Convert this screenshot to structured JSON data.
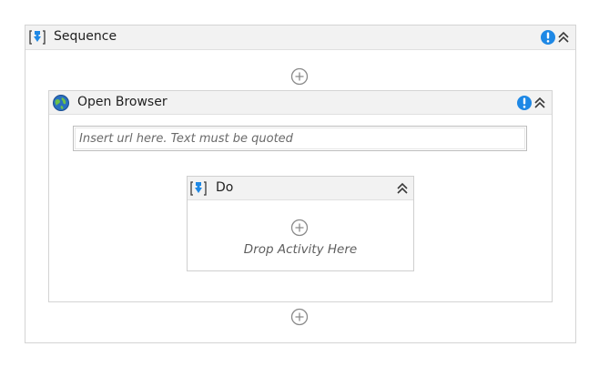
{
  "sequence": {
    "title": "Sequence",
    "icons": [
      "sequence-icon",
      "warning-icon",
      "collapse-icon"
    ]
  },
  "open_browser": {
    "title": "Open Browser",
    "url_placeholder": "Insert url here. Text must be quoted",
    "url_value": "",
    "icons": [
      "globe-icon",
      "warning-icon",
      "collapse-icon"
    ]
  },
  "do": {
    "title": "Do",
    "drop_hint": "Drop Activity Here",
    "icons": [
      "sequence-icon",
      "collapse-icon",
      "add-icon"
    ]
  },
  "colors": {
    "accent_blue": "#1e88e5",
    "header_bg": "#f2f2f2",
    "border": "#d4d4d4"
  }
}
